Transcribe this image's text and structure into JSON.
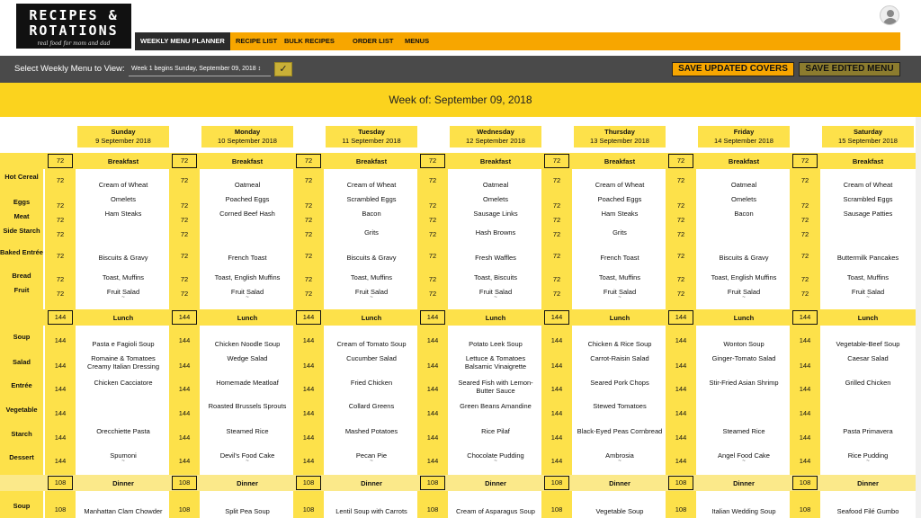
{
  "header": {
    "logo_line1": "RECIPES &",
    "logo_line2": "ROTATIONS",
    "logo_tagline": "real food for mom and dad",
    "nav": [
      "WEEKLY MENU PLANNER",
      "RECIPE LIST",
      "BULK RECIPES",
      "ORDER LIST",
      "MENUS"
    ],
    "active_nav": 0
  },
  "toolbar": {
    "label": "Select Weekly Menu to View:",
    "select_value": "Week 1 begins Sunday, September 09, 2018 ↕",
    "check": "✓",
    "save_covers": "SAVE UPDATED COVERS",
    "save_edited": "SAVE EDITED MENU"
  },
  "week_title": "Week of: September 09, 2018",
  "days": [
    {
      "name": "Sunday",
      "date": "9 September 2018"
    },
    {
      "name": "Monday",
      "date": "10 September 2018"
    },
    {
      "name": "Tuesday",
      "date": "11 September 2018"
    },
    {
      "name": "Wednesday",
      "date": "12 September 2018"
    },
    {
      "name": "Thursday",
      "date": "13 September 2018"
    },
    {
      "name": "Friday",
      "date": "14 September 2018"
    },
    {
      "name": "Saturday",
      "date": "15 September 2018"
    }
  ],
  "meals": [
    {
      "title": "Breakfast",
      "covers": "72",
      "rows": [
        {
          "label": "Hot Cereal",
          "items": [
            "Cream of Wheat",
            "Oatmeal",
            "Cream of Wheat",
            "Oatmeal",
            "Cream of Wheat",
            "Oatmeal",
            "Cream of Wheat"
          ]
        },
        {
          "label": "Eggs",
          "items": [
            "Omelets",
            "Poached Eggs",
            "Scrambled Eggs",
            "Omelets",
            "Poached Eggs",
            "Omelets",
            "Scrambled Eggs"
          ]
        },
        {
          "label": "Meat",
          "items": [
            "Ham Steaks",
            "Corned Beef Hash",
            "Bacon",
            "Sausage Links",
            "Ham Steaks",
            "Bacon",
            "Sausage Patties"
          ]
        },
        {
          "label": "Side Starch",
          "items": [
            "",
            "",
            "Grits",
            "Hash Browns",
            "Grits",
            "",
            ""
          ]
        },
        {
          "label": "Baked Entrée",
          "items": [
            "Biscuits & Gravy",
            "French Toast",
            "Biscuits & Gravy",
            "Fresh Waffles",
            "French Toast",
            "Biscuits & Gravy",
            "Buttermilk Pancakes"
          ]
        },
        {
          "label": "Bread",
          "items": [
            "Toast, Muffins",
            "Toast, English Muffins",
            "Toast, Muffins",
            "Toast, Biscuits",
            "Toast, Muffins",
            "Toast, English Muffins",
            "Toast, Muffins"
          ]
        },
        {
          "label": "Fruit",
          "items": [
            "Fruit Salad",
            "Fruit Salad",
            "Fruit Salad",
            "Fruit Salad",
            "Fruit Salad",
            "Fruit Salad",
            "Fruit Salad"
          ]
        }
      ]
    },
    {
      "title": "Lunch",
      "covers": "144",
      "rows": [
        {
          "label": "Soup",
          "items": [
            "Pasta e Fagioli Soup",
            "Chicken Noodle Soup",
            "Cream of Tomato Soup",
            "Potato Leek Soup",
            "Chicken & Rice Soup",
            "Wonton Soup",
            "Vegetable-Beef Soup"
          ]
        },
        {
          "label": "Salad",
          "items": [
            "Romaine & Tomatoes Creamy Italian Dressing",
            "Wedge Salad",
            "Cucumber Salad",
            "Lettuce & Tomatoes Balsamic Vinaigrette",
            "Carrot-Raisin Salad",
            "Ginger-Tomato Salad",
            "Caesar Salad"
          ]
        },
        {
          "label": "Entrée",
          "items": [
            "Chicken Cacciatore",
            "Homemade Meatloaf",
            "Fried Chicken",
            "Seared Fish with Lemon-Butter Sauce",
            "Seared Pork Chops",
            "Stir-Fried Asian Shrimp",
            "Grilled Chicken"
          ]
        },
        {
          "label": "Vegetable",
          "items": [
            "",
            "Roasted Brussels Sprouts",
            "Collard Greens",
            "Green Beans Amandine",
            "Stewed Tomatoes",
            "",
            ""
          ]
        },
        {
          "label": "Starch",
          "items": [
            "Orecchiette Pasta",
            "Steamed Rice",
            "Mashed Potatoes",
            "Rice Pilaf",
            "Black-Eyed Peas Cornbread",
            "Steamed Rice",
            "Pasta Primavera"
          ]
        },
        {
          "label": "Dessert",
          "items": [
            "Spumoni",
            "Devil's Food Cake",
            "Pecan Pie",
            "Chocolate Pudding",
            "Ambrosia",
            "Angel Food Cake",
            "Rice Pudding"
          ]
        }
      ]
    },
    {
      "title": "Dinner",
      "covers": "108",
      "rows": [
        {
          "label": "Soup",
          "items": [
            "Manhattan Clam Chowder",
            "Split Pea Soup",
            "Lentil Soup with Carrots",
            "Cream of Asparagus Soup",
            "Vegetable Soup",
            "Italian Wedding Soup",
            "Seafood Filé Gumbo"
          ]
        }
      ]
    }
  ]
}
